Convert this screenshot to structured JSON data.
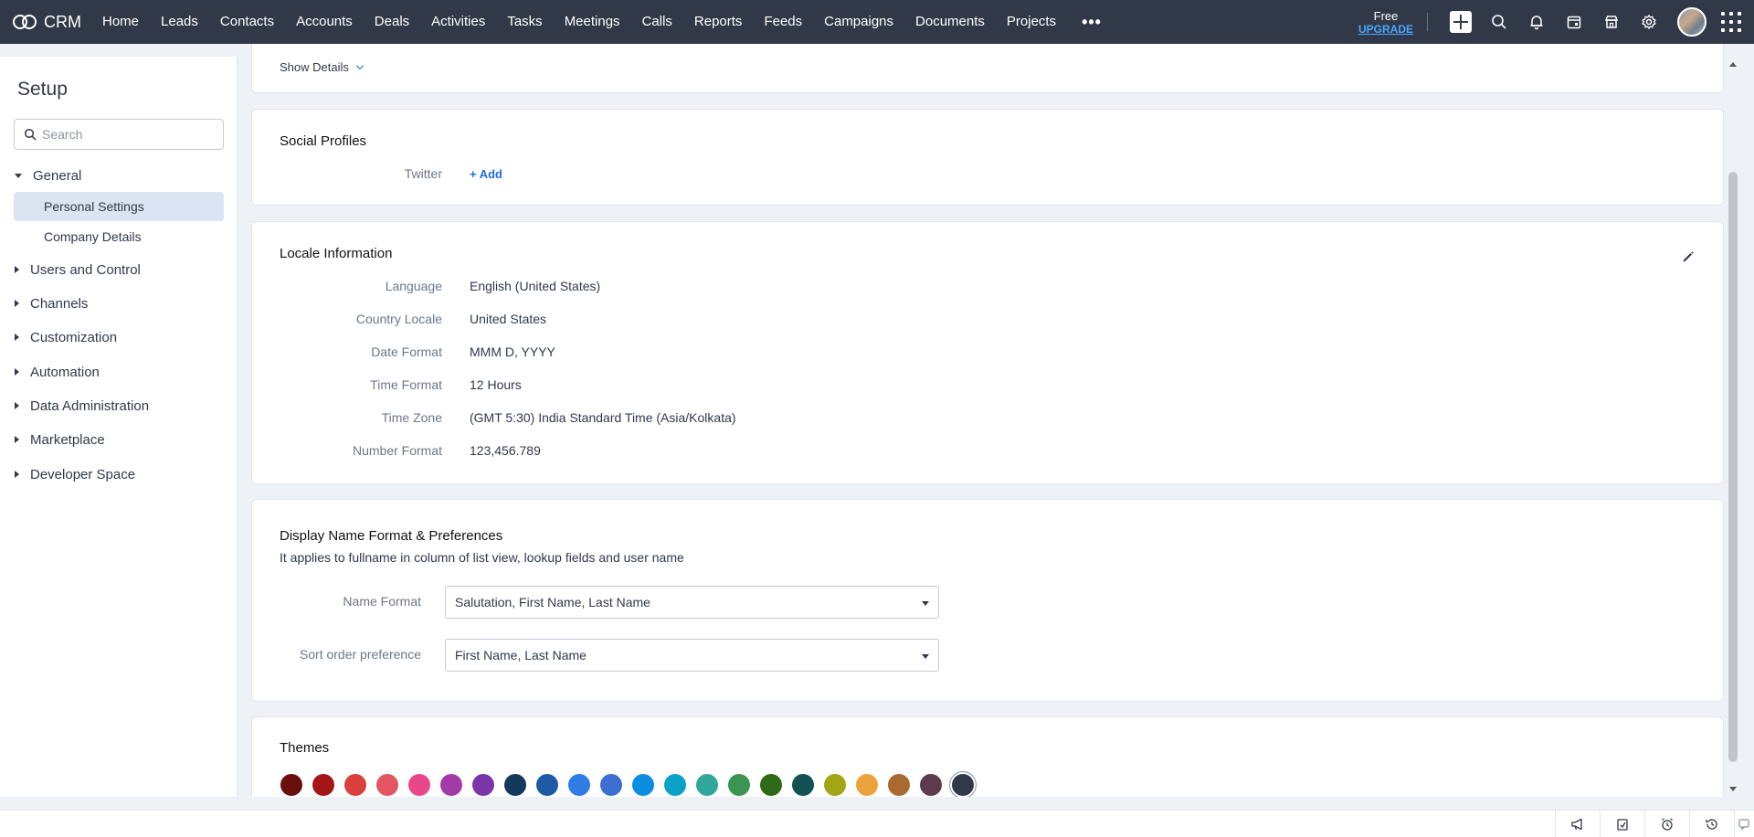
{
  "app": {
    "name": "CRM"
  },
  "nav": {
    "items": [
      "Home",
      "Leads",
      "Contacts",
      "Accounts",
      "Deals",
      "Activities",
      "Tasks",
      "Meetings",
      "Calls",
      "Reports",
      "Feeds",
      "Campaigns",
      "Documents",
      "Projects"
    ],
    "more": "•••"
  },
  "topright": {
    "plan": "Free",
    "upgrade": "UPGRADE"
  },
  "sidebar": {
    "title": "Setup",
    "search_placeholder": "Search",
    "general": "General",
    "general_items": [
      "Personal Settings",
      "Company Details"
    ],
    "sections": [
      "Users and Control",
      "Channels",
      "Customization",
      "Automation",
      "Data Administration",
      "Marketplace",
      "Developer Space"
    ]
  },
  "show_details": "Show Details",
  "social": {
    "title": "Social Profiles",
    "twitter_label": "Twitter",
    "add_label": "+ Add"
  },
  "locale": {
    "title": "Locale Information",
    "rows": [
      {
        "label": "Language",
        "value": "English (United States)"
      },
      {
        "label": "Country Locale",
        "value": "United States"
      },
      {
        "label": "Date Format",
        "value": "MMM D, YYYY"
      },
      {
        "label": "Time Format",
        "value": "12 Hours"
      },
      {
        "label": "Time Zone",
        "value": "(GMT 5:30) India Standard Time (Asia/Kolkata)"
      },
      {
        "label": "Number Format",
        "value": "123,456.789"
      }
    ]
  },
  "display_name": {
    "title": "Display Name Format & Preferences",
    "subtitle": "It applies to fullname in column of list view, lookup fields and user name",
    "name_format_label": "Name Format",
    "name_format_value": "Salutation, First Name, Last Name",
    "sort_order_label": "Sort order preference",
    "sort_order_value": "First Name, Last Name"
  },
  "themes": {
    "title": "Themes",
    "colors": [
      "#6b0e0e",
      "#a51616",
      "#d9403e",
      "#e25563",
      "#e8488a",
      "#a43aa8",
      "#7a35a8",
      "#15395c",
      "#1f5aa6",
      "#2f7ce6",
      "#3c6fd1",
      "#0b8de0",
      "#0aa1c8",
      "#2fa89b",
      "#3b9552",
      "#2f6a16",
      "#135153",
      "#a2a514",
      "#eda33b",
      "#a86a2f",
      "#5d3a4c",
      "#313949"
    ],
    "selected_index": 21
  }
}
